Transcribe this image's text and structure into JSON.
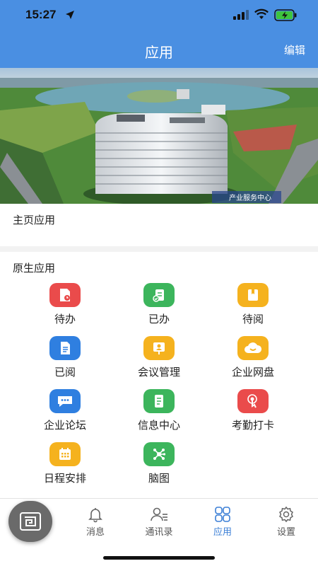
{
  "status_bar": {
    "time": "15:27"
  },
  "header": {
    "title": "应用",
    "edit_label": "编辑"
  },
  "banner": {
    "caption": "产业服务中心"
  },
  "home_section": {
    "title": "主页应用"
  },
  "native_section": {
    "title": "原生应用",
    "apps": [
      {
        "label": "待办",
        "icon": "todo-icon",
        "color": "#ea4b4b"
      },
      {
        "label": "已办",
        "icon": "done-icon",
        "color": "#3cb55c"
      },
      {
        "label": "待阅",
        "icon": "to-read-icon",
        "color": "#f5b21e"
      },
      {
        "label": "已阅",
        "icon": "read-icon",
        "color": "#2f7fe0"
      },
      {
        "label": "会议管理",
        "icon": "meeting-icon",
        "color": "#f5b21e"
      },
      {
        "label": "企业网盘",
        "icon": "cloud-drive-icon",
        "color": "#f5b21e"
      },
      {
        "label": "企业论坛",
        "icon": "forum-icon",
        "color": "#2f7fe0"
      },
      {
        "label": "信息中心",
        "icon": "info-center-icon",
        "color": "#3cb55c"
      },
      {
        "label": "考勤打卡",
        "icon": "attendance-icon",
        "color": "#ea4b4b"
      },
      {
        "label": "日程安排",
        "icon": "schedule-icon",
        "color": "#f5b21e"
      },
      {
        "label": "脑图",
        "icon": "mind-map-icon",
        "color": "#3cb55c"
      }
    ]
  },
  "tabbar": {
    "tabs": [
      {
        "label": "消息",
        "icon": "bell-icon"
      },
      {
        "label": "通讯录",
        "icon": "contacts-icon"
      },
      {
        "label": "应用",
        "icon": "apps-icon",
        "active": true
      },
      {
        "label": "设置",
        "icon": "gear-icon"
      }
    ]
  },
  "colors": {
    "header_bg": "#4a8fe2",
    "active_tab": "#3b7fd6"
  }
}
